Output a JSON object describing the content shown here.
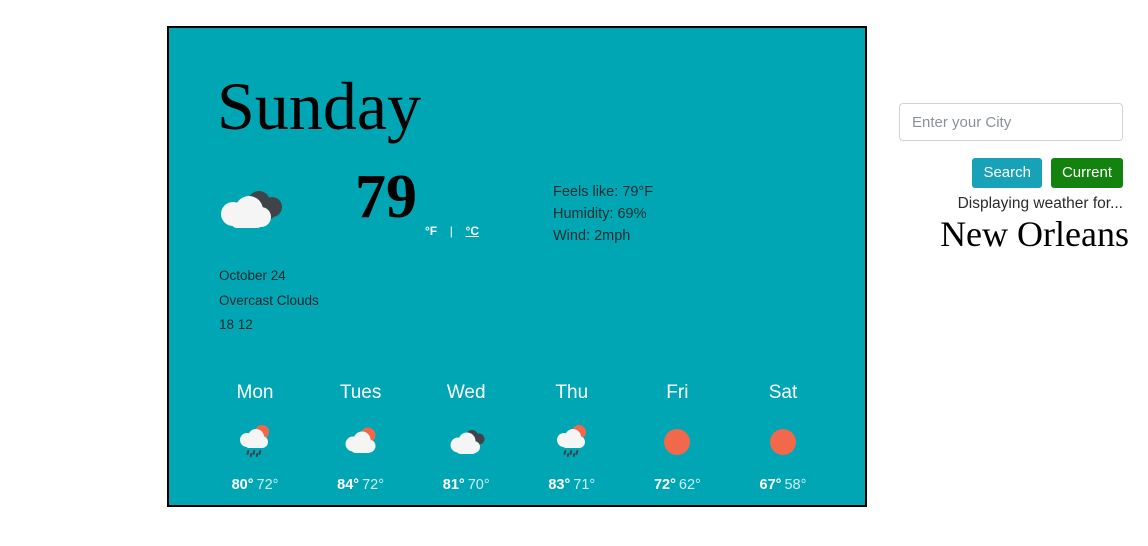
{
  "card": {
    "background_color": "#00a6b4",
    "border_color": "#000000",
    "day_title": "Sunday",
    "current": {
      "icon": "overcast-clouds-icon",
      "temperature": "79",
      "unit_fahrenheit": "°F",
      "unit_separator": "|",
      "unit_celsius": "°C",
      "active_unit": "celsius",
      "feels_like": "Feels like: 79°F",
      "humidity": "Humidity: 69%",
      "wind": "Wind: 2mph"
    },
    "meta": {
      "date": "October 24",
      "description": "Overcast Clouds",
      "extra": "18 12"
    },
    "forecast": [
      {
        "day": "Mon",
        "icon": "sun-cloud-rain-icon",
        "high": "80°",
        "low": "72°"
      },
      {
        "day": "Tues",
        "icon": "sun-cloud-icon",
        "high": "84°",
        "low": "72°"
      },
      {
        "day": "Wed",
        "icon": "overcast-clouds-icon",
        "high": "81°",
        "low": "70°"
      },
      {
        "day": "Thu",
        "icon": "sun-cloud-rain-icon",
        "high": "83°",
        "low": "71°"
      },
      {
        "day": "Fri",
        "icon": "sun-icon",
        "high": "72°",
        "low": "62°"
      },
      {
        "day": "Sat",
        "icon": "sun-icon",
        "high": "67°",
        "low": "58°"
      }
    ]
  },
  "side_panel": {
    "city_input_value": "",
    "city_input_placeholder": "Enter your City",
    "search_label": "Search",
    "current_label": "Current",
    "search_color": "#17a2b8",
    "current_color": "#13820f",
    "displaying_text": "Displaying weather for...",
    "city_name": "New Orleans"
  },
  "colors": {
    "sun_orange": "#f2684b",
    "cloud_white": "#f5f5f5",
    "cloud_dark": "#3f4448",
    "rain_drop": "#3f4448"
  }
}
